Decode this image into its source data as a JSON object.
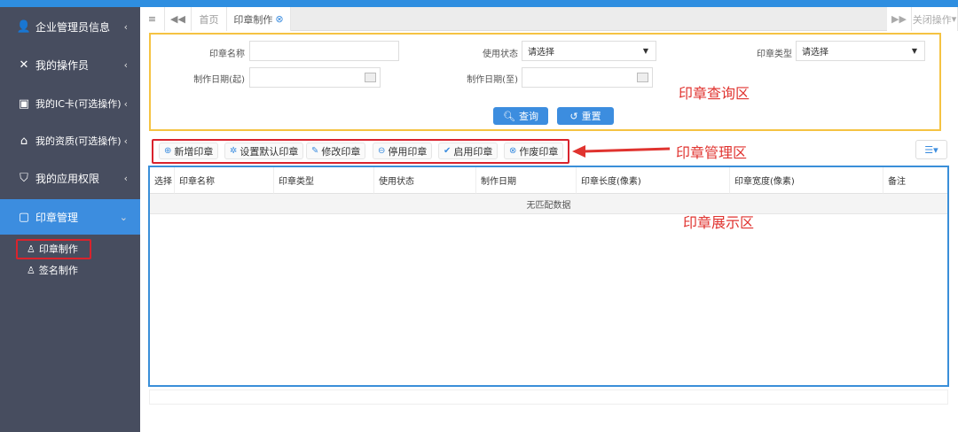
{
  "sidebar": {
    "items": [
      {
        "label": "企业管理员信息",
        "icon": "user-icon"
      },
      {
        "label": "我的操作员",
        "icon": "wrench-icon"
      },
      {
        "label": "我的IC卡(可选操作)",
        "icon": "id-card-icon"
      },
      {
        "label": "我的资质(可选操作)",
        "icon": "home-icon"
      },
      {
        "label": "我的应用权限",
        "icon": "shield-icon"
      },
      {
        "label": "印章管理",
        "icon": "book-icon",
        "active": true
      }
    ],
    "subitems": [
      {
        "label": "印章制作",
        "icon": "stamp-icon",
        "selected": true
      },
      {
        "label": "签名制作",
        "icon": "stamp-icon"
      }
    ]
  },
  "tabs": {
    "home": "首页",
    "current": "印章制作",
    "close_ops": "关闭操作"
  },
  "query": {
    "name_label": "印章名称",
    "name_value": "",
    "status_label": "使用状态",
    "status_value": "请选择",
    "type_label": "印章类型",
    "type_value": "请选择",
    "date_from_label": "制作日期(起)",
    "date_to_label": "制作日期(至)",
    "search": "查询",
    "reset": "重置"
  },
  "toolbar": [
    "新增印章",
    "设置默认印章",
    "修改印章",
    "停用印章",
    "启用印章",
    "作废印章"
  ],
  "table": {
    "headers": [
      "选择",
      "印章名称",
      "印章类型",
      "使用状态",
      "制作日期",
      "印章长度(像素)",
      "印章宽度(像素)",
      "备注"
    ],
    "empty": "无匹配数据"
  },
  "annotations": {
    "query_area": "印章查询区",
    "manage_area": "印章管理区",
    "display_area": "印章展示区"
  },
  "colors": {
    "accent": "#3c8ddf",
    "sidebar": "#474d5f",
    "annotation": "#e0332f",
    "query_border": "#f5c342"
  }
}
